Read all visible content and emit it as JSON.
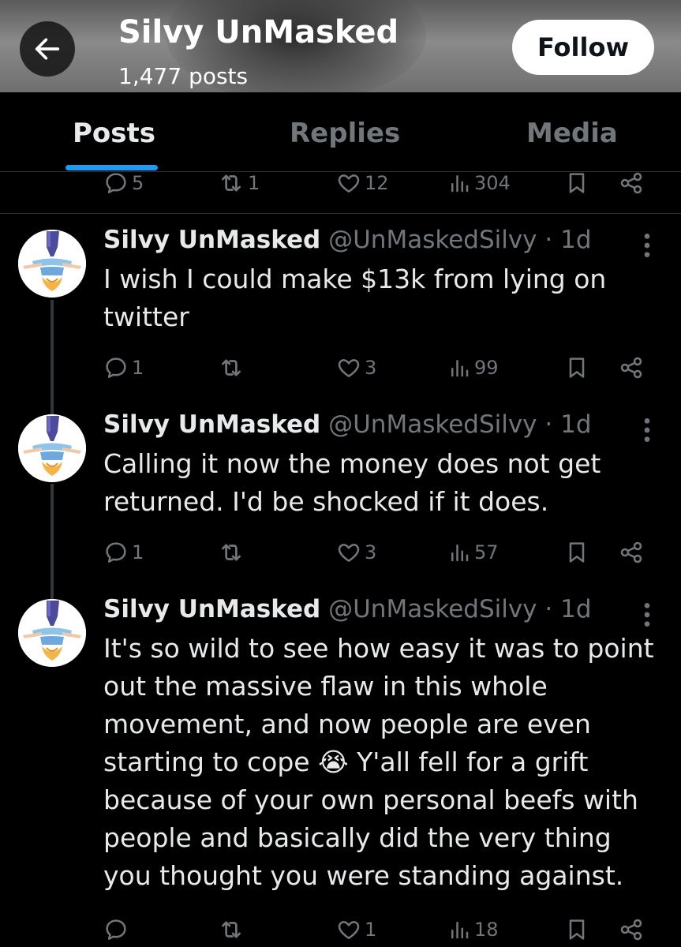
{
  "header": {
    "title": "Silvy UnMasked",
    "post_count": "1,477 posts",
    "follow_label": "Follow"
  },
  "tabs": [
    {
      "label": "Posts",
      "active": true
    },
    {
      "label": "Replies",
      "active": false
    },
    {
      "label": "Media",
      "active": false
    }
  ],
  "top_actions": {
    "replies": "5",
    "reposts": "1",
    "likes": "12",
    "views": "304"
  },
  "posts": [
    {
      "name": "Silvy UnMasked",
      "handle": "@UnMaskedSilvy",
      "time": "1d",
      "text": "I wish I could make $13k from lying on twitter",
      "replies": "1",
      "reposts": "",
      "likes": "3",
      "views": "99"
    },
    {
      "name": "Silvy UnMasked",
      "handle": "@UnMaskedSilvy",
      "time": "1d",
      "text": "Calling it now the money does not get returned. I'd be shocked if it does.",
      "replies": "1",
      "reposts": "",
      "likes": "3",
      "views": "57"
    },
    {
      "name": "Silvy UnMasked",
      "handle": "@UnMaskedSilvy",
      "time": "1d",
      "text": "It's so wild to see how easy it was to point out the massive flaw in this whole movement, and now people are even starting to cope 😭 Y'all fell for a grift because of your own personal beefs with people and basically did the very thing you thought you were standing against.",
      "replies": "",
      "reposts": "",
      "likes": "1",
      "views": "18"
    }
  ],
  "colors": {
    "background": "#000000",
    "text": "#e7e9ea",
    "muted": "#71767b",
    "accent": "#1d9bf0",
    "divider": "#2f3336"
  },
  "icons": {
    "back": "arrow-left-icon",
    "reply": "speech-bubble-icon",
    "repost": "repost-arrows-icon",
    "like": "heart-icon",
    "views": "bar-chart-icon",
    "bookmark": "bookmark-icon",
    "share": "share-icon",
    "more": "vertical-dots-icon"
  }
}
